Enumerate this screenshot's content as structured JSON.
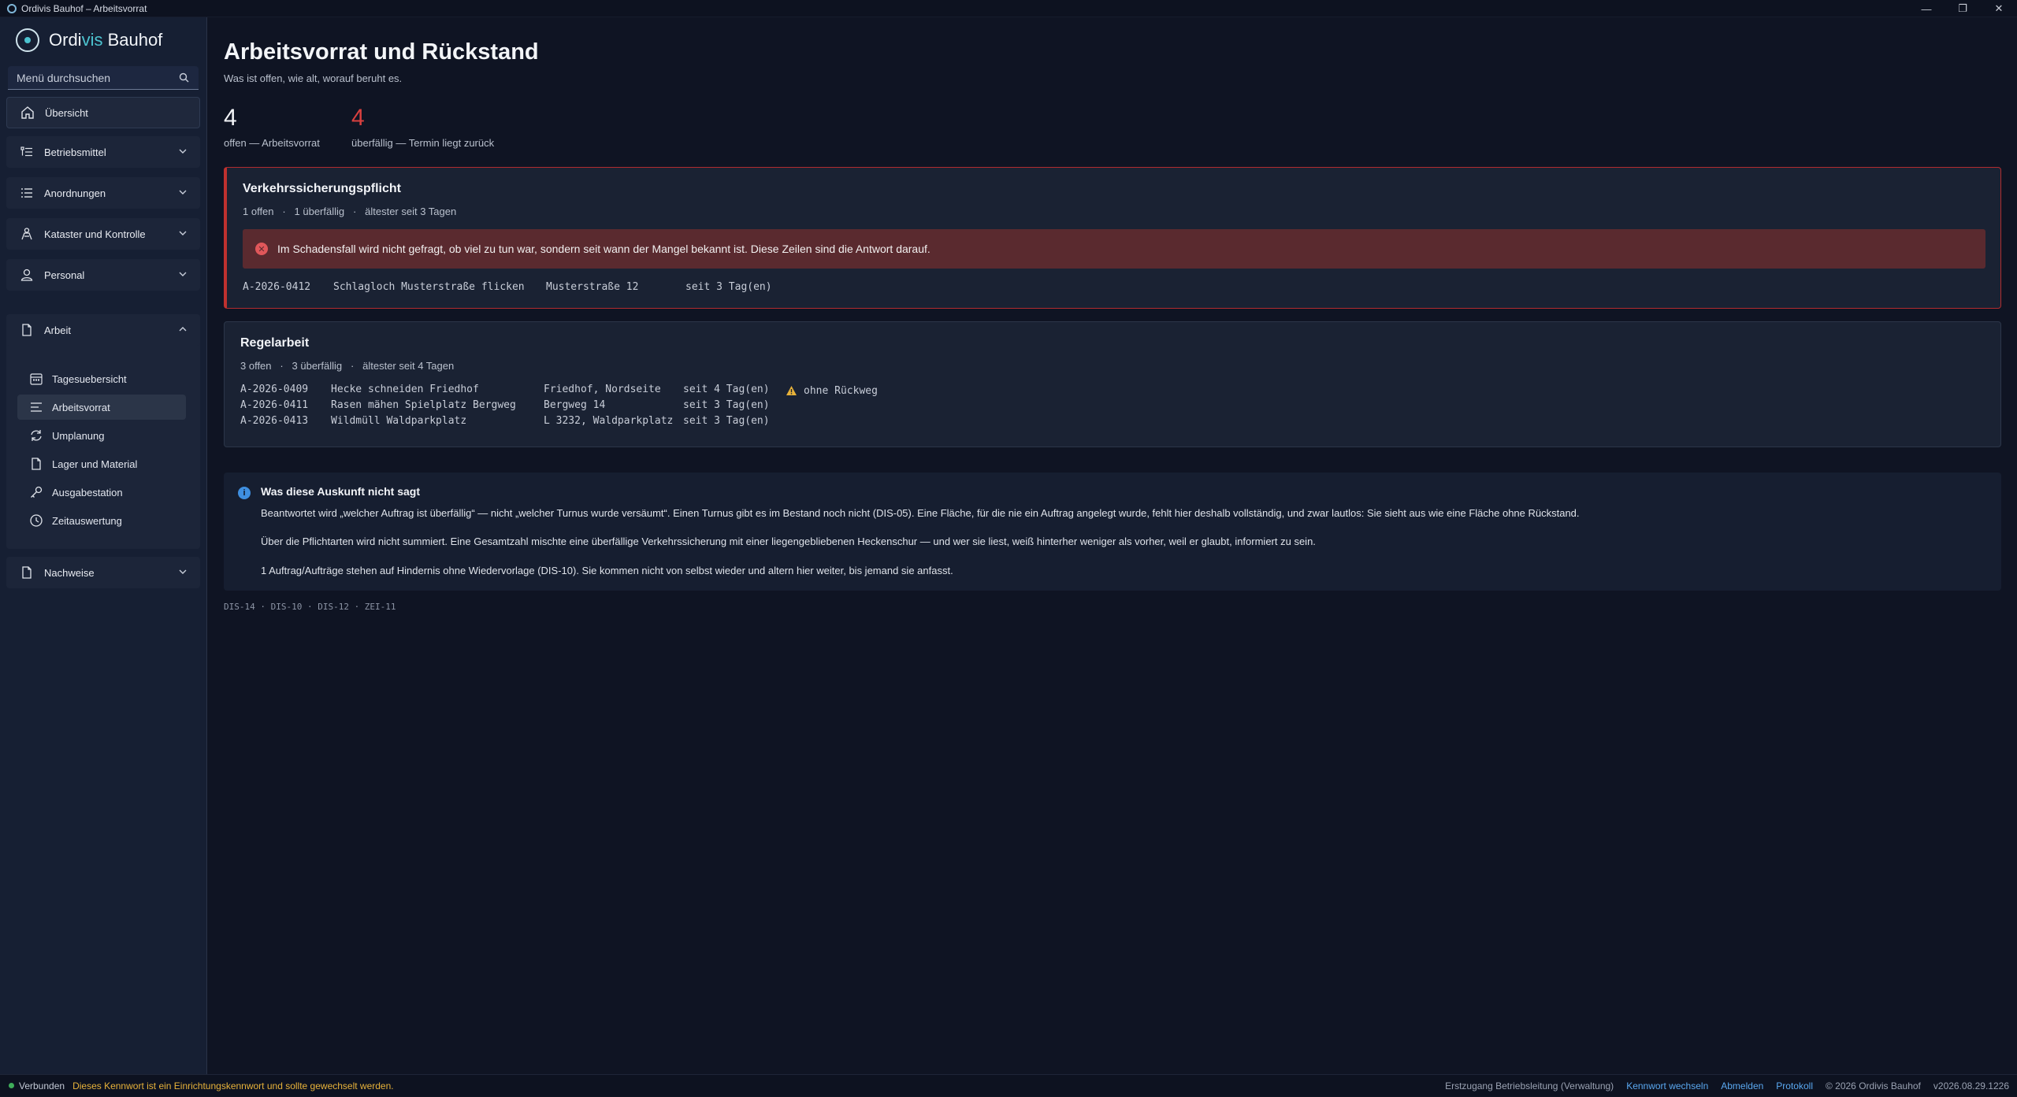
{
  "window": {
    "title": "Ordivis Bauhof – Arbeitsvorrat",
    "minimize": "—",
    "restore": "❐",
    "close": "✕"
  },
  "brand": {
    "part1": "Ordi",
    "part2": "vis",
    "part3": " Bauhof"
  },
  "search": {
    "placeholder": "Menü durchsuchen"
  },
  "nav": {
    "overview": "Übersicht",
    "betriebsmittel": "Betriebsmittel",
    "anordnungen": "Anordnungen",
    "kataster": "Kataster und Kontrolle",
    "personal": "Personal",
    "arbeit": "Arbeit",
    "nachweise": "Nachweise",
    "sub": {
      "tagesuebersicht": "Tagesuebersicht",
      "arbeitsvorrat": "Arbeitsvorrat",
      "umplanung": "Umplanung",
      "lager": "Lager und Material",
      "ausgabestation": "Ausgabestation",
      "zeitauswertung": "Zeitauswertung"
    }
  },
  "page": {
    "title": "Arbeitsvorrat und Rückstand",
    "subtitle": "Was ist offen, wie alt, worauf beruht es."
  },
  "kpis": {
    "open": {
      "value": "4",
      "label": "offen — Arbeitsvorrat"
    },
    "overdue": {
      "value": "4",
      "label": "überfällig — Termin liegt zurück"
    }
  },
  "groups": {
    "vsp": {
      "title": "Verkehrssicherungspflicht",
      "meta": "1 offen   ·   1 überfällig   ·   ältester seit 3 Tagen",
      "alert": "Im Schadensfall wird nicht gefragt, ob viel zu tun war, sondern seit wann der Mangel bekannt ist. Diese Zeilen sind die Antwort darauf.",
      "rows": [
        {
          "id": "A-2026-0412",
          "title": "Schlagloch Musterstraße flicken",
          "location": "Musterstraße 12",
          "age": "seit 3 Tag(en)"
        }
      ]
    },
    "regel": {
      "title": "Regelarbeit",
      "meta": "3 offen   ·   3 überfällig   ·   ältester seit 4 Tagen",
      "rows": [
        {
          "id": "A-2026-0409",
          "title": "Hecke schneiden Friedhof",
          "location": "Friedhof, Nordseite",
          "age": "seit 4 Tag(en)",
          "warning": "ohne Rückweg"
        },
        {
          "id": "A-2026-0411",
          "title": "Rasen mähen Spielplatz Bergweg",
          "location": "Bergweg 14",
          "age": "seit 3 Tag(en)"
        },
        {
          "id": "A-2026-0413",
          "title": "Wildmüll Waldparkplatz",
          "location": "L 3232, Waldparkplatz",
          "age": "seit 3 Tag(en)"
        }
      ]
    }
  },
  "info": {
    "title": "Was diese Auskunft nicht sagt",
    "p1": "Beantwortet wird „welcher Auftrag ist überfällig“ — nicht „welcher Turnus wurde versäumt“. Einen Turnus gibt es im Bestand noch nicht (DIS-05). Eine Fläche, für die nie ein Auftrag angelegt wurde, fehlt hier deshalb vollständig, und zwar lautlos: Sie sieht aus wie eine Fläche ohne Rückstand.",
    "p2": "Über die Pflichtarten wird nicht summiert. Eine Gesamtzahl mischte eine überfällige Verkehrssicherung mit einer liegengebliebenen Heckenschur — und wer sie liest, weiß hinterher weniger als vorher, weil er glaubt, informiert zu sein.",
    "p3": "1 Auftrag/Aufträge stehen auf Hindernis ohne Wiedervorlage (DIS-10). Sie kommen nicht von selbst wieder und altern hier weiter, bis jemand sie anfasst."
  },
  "refs": "DIS-14 · DIS-10 · DIS-12 · ZEI-11",
  "status": {
    "connected": "Verbunden",
    "warning": "Dieses Kennwort ist ein Einrichtungskennwort und sollte gewechselt werden.",
    "user": "Erstzugang Betriebsleitung (Verwaltung)",
    "change_pw": "Kennwort wechseln",
    "logout": "Abmelden",
    "protocol": "Protokoll",
    "copyright": "© 2026 Ordivis Bauhof",
    "version": "v2026.08.29.1226"
  },
  "colors": {
    "accent": "#4cc3d0",
    "danger": "#c0312f",
    "warning": "#e7b23a",
    "link": "#5aa8f0"
  }
}
